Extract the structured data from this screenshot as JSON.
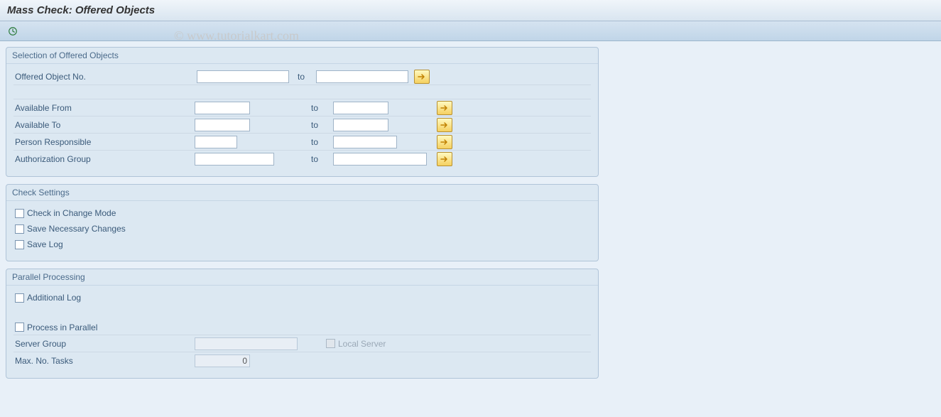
{
  "page_title": "Mass Check: Offered Objects",
  "watermark": "© www.tutorialkart.com",
  "section1": {
    "title": "Selection of Offered Objects",
    "rows": {
      "offered_no": {
        "label": "Offered Object No.",
        "to": "to"
      },
      "avail_from": {
        "label": "Available From",
        "to": "to"
      },
      "avail_to": {
        "label": "Available To",
        "to": "to"
      },
      "person_resp": {
        "label": "Person Responsible",
        "to": "to"
      },
      "auth_group": {
        "label": "Authorization Group",
        "to": "to"
      }
    }
  },
  "section2": {
    "title": "Check Settings",
    "cb1": "Check in Change Mode",
    "cb2": "Save Necessary Changes",
    "cb3": "Save Log"
  },
  "section3": {
    "title": "Parallel Processing",
    "cb_addlog": "Additional Log",
    "cb_parallel": "Process in Parallel",
    "server_group": "Server Group",
    "local_server": "Local Server",
    "max_tasks": "Max. No. Tasks",
    "max_tasks_value": "0"
  }
}
